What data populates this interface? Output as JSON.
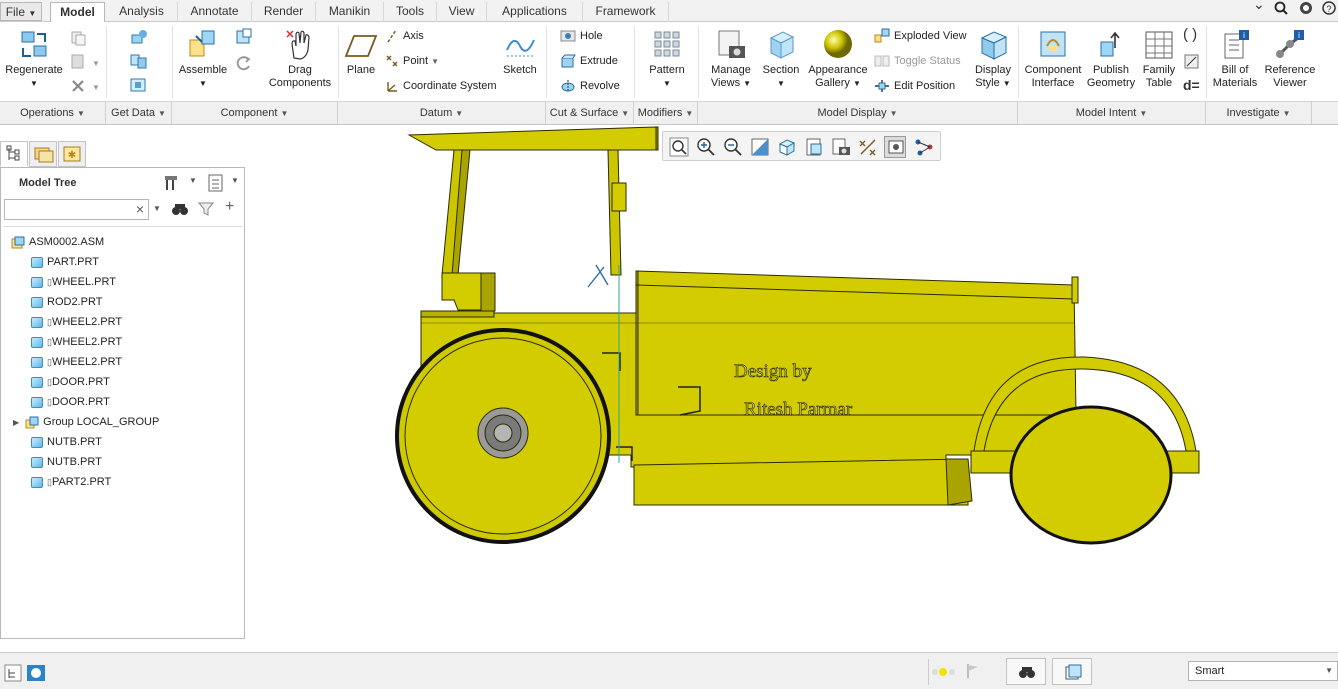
{
  "menubar": {
    "file": "File",
    "tabs": [
      "Model",
      "Analysis",
      "Annotate",
      "Render",
      "Manikin",
      "Tools",
      "View",
      "Applications",
      "Framework"
    ]
  },
  "ribbon": {
    "regenerate": "Regenerate",
    "assemble": "Assemble",
    "drag_components": [
      "Drag",
      "Components"
    ],
    "plane": "Plane",
    "axis": "Axis",
    "point": "Point",
    "coordinate_system": "Coordinate System",
    "sketch": "Sketch",
    "hole": "Hole",
    "extrude": "Extrude",
    "revolve": "Revolve",
    "pattern": "Pattern",
    "manage_views": [
      "Manage",
      "Views"
    ],
    "section": "Section",
    "appearance_gallery": [
      "Appearance",
      "Gallery"
    ],
    "exploded_view": "Exploded View",
    "toggle_status": "Toggle Status",
    "edit_position": "Edit Position",
    "display_style": [
      "Display",
      "Style"
    ],
    "component_interface": [
      "Component",
      "Interface"
    ],
    "publish_geometry": [
      "Publish",
      "Geometry"
    ],
    "family_table": [
      "Family",
      "Table"
    ],
    "bill_of_materials": [
      "Bill of",
      "Materials"
    ],
    "reference_viewer": [
      "Reference",
      "Viewer"
    ]
  },
  "groups": [
    "Operations",
    "Get Data",
    "Component",
    "Datum",
    "Cut & Surface",
    "Modifiers",
    "Model Display",
    "Model Intent",
    "Investigate"
  ],
  "model_tree": {
    "title": "Model Tree",
    "search_value": "",
    "root": "ASM0002.ASM",
    "items": [
      {
        "label": "PART.PRT",
        "marker": false
      },
      {
        "label": "WHEEL.PRT",
        "marker": true
      },
      {
        "label": "ROD2.PRT",
        "marker": false
      },
      {
        "label": "WHEEL2.PRT",
        "marker": true
      },
      {
        "label": "WHEEL2.PRT",
        "marker": true
      },
      {
        "label": "WHEEL2.PRT",
        "marker": true
      },
      {
        "label": "DOOR.PRT",
        "marker": true
      },
      {
        "label": "DOOR.PRT",
        "marker": true
      },
      {
        "label": "Group LOCAL_GROUP",
        "marker": false,
        "group": true
      },
      {
        "label": "NUTB.PRT",
        "marker": false
      },
      {
        "label": "NUTB.PRT",
        "marker": false
      },
      {
        "label": "PART2.PRT",
        "marker": true
      }
    ]
  },
  "model": {
    "text_line1": "Design by",
    "text_line2": "Ritesh Parmar",
    "body_color": "#d2cc00",
    "edge_color": "#2b2b00"
  },
  "status": {
    "filter": "Smart"
  }
}
